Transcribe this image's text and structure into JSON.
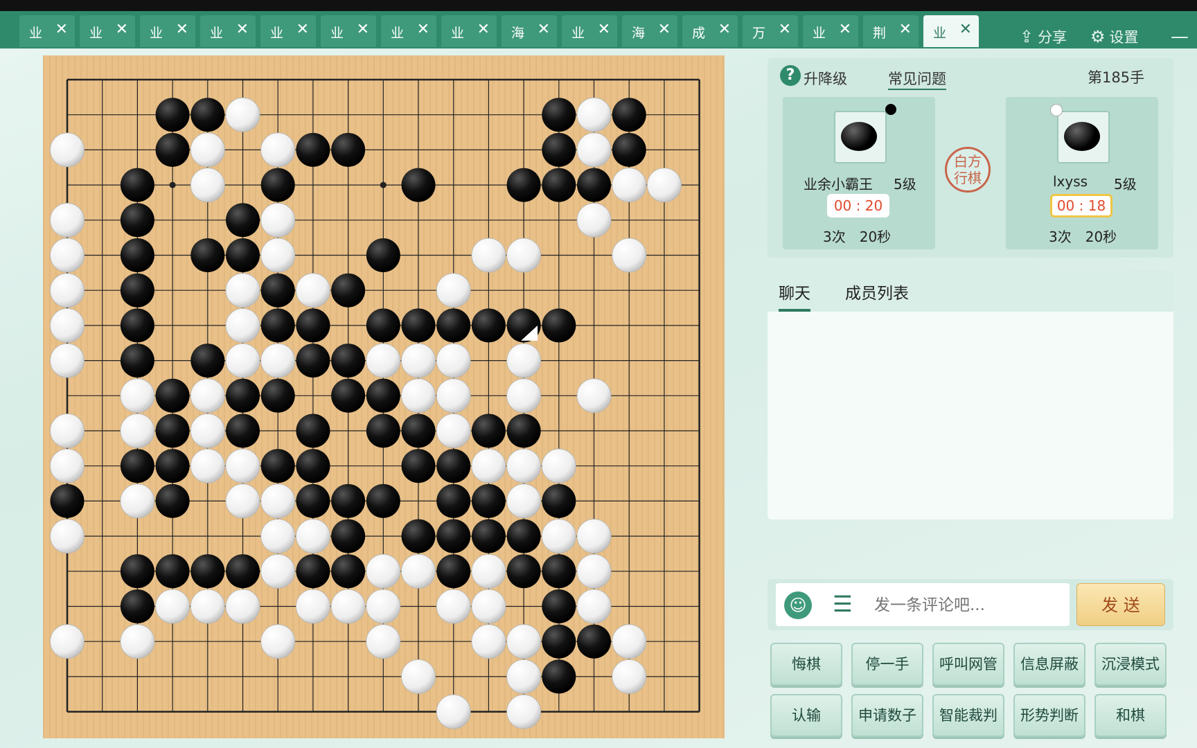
{
  "tabs": [
    {
      "label": "业",
      "close": "✕"
    },
    {
      "label": "业",
      "close": "✕"
    },
    {
      "label": "业",
      "close": "✕"
    },
    {
      "label": "业",
      "close": "✕"
    },
    {
      "label": "业",
      "close": "✕"
    },
    {
      "label": "业",
      "close": "✕"
    },
    {
      "label": "业",
      "close": "✕"
    },
    {
      "label": "业",
      "close": "✕"
    },
    {
      "label": "海",
      "close": "✕"
    },
    {
      "label": "业",
      "close": "✕"
    },
    {
      "label": "海",
      "close": "✕"
    },
    {
      "label": "成",
      "close": "✕"
    },
    {
      "label": "万",
      "close": "✕"
    },
    {
      "label": "业",
      "close": "✕"
    },
    {
      "label": "荆",
      "close": "✕"
    },
    {
      "label": "业",
      "close": "✕",
      "active": true
    }
  ],
  "topbar": {
    "share_label": "分享",
    "settings_label": "设置",
    "minimize_glyph": "—"
  },
  "board": {
    "size": 19,
    "last_move": [
      13,
      7
    ],
    "black": [
      [
        3,
        1
      ],
      [
        4,
        1
      ],
      [
        14,
        1
      ],
      [
        16,
        1
      ],
      [
        3,
        2
      ],
      [
        7,
        2
      ],
      [
        8,
        2
      ],
      [
        14,
        2
      ],
      [
        16,
        2
      ],
      [
        2,
        3
      ],
      [
        6,
        3
      ],
      [
        10,
        3
      ],
      [
        13,
        3
      ],
      [
        14,
        3
      ],
      [
        15,
        3
      ],
      [
        2,
        4
      ],
      [
        5,
        4
      ],
      [
        2,
        5
      ],
      [
        4,
        5
      ],
      [
        5,
        5
      ],
      [
        9,
        5
      ],
      [
        2,
        6
      ],
      [
        6,
        6
      ],
      [
        8,
        6
      ],
      [
        2,
        7
      ],
      [
        6,
        7
      ],
      [
        7,
        7
      ],
      [
        9,
        7
      ],
      [
        10,
        7
      ],
      [
        11,
        7
      ],
      [
        12,
        7
      ],
      [
        13,
        7
      ],
      [
        14,
        7
      ],
      [
        2,
        8
      ],
      [
        4,
        8
      ],
      [
        7,
        8
      ],
      [
        8,
        8
      ],
      [
        3,
        9
      ],
      [
        5,
        9
      ],
      [
        6,
        9
      ],
      [
        8,
        9
      ],
      [
        9,
        9
      ],
      [
        3,
        10
      ],
      [
        5,
        10
      ],
      [
        7,
        10
      ],
      [
        9,
        10
      ],
      [
        10,
        10
      ],
      [
        12,
        10
      ],
      [
        13,
        10
      ],
      [
        2,
        11
      ],
      [
        3,
        11
      ],
      [
        6,
        11
      ],
      [
        7,
        11
      ],
      [
        10,
        11
      ],
      [
        11,
        11
      ],
      [
        0,
        12
      ],
      [
        3,
        12
      ],
      [
        7,
        12
      ],
      [
        8,
        12
      ],
      [
        9,
        12
      ],
      [
        11,
        12
      ],
      [
        12,
        12
      ],
      [
        14,
        12
      ],
      [
        8,
        13
      ],
      [
        10,
        13
      ],
      [
        11,
        13
      ],
      [
        12,
        13
      ],
      [
        13,
        13
      ],
      [
        2,
        14
      ],
      [
        3,
        14
      ],
      [
        4,
        14
      ],
      [
        5,
        14
      ],
      [
        7,
        14
      ],
      [
        8,
        14
      ],
      [
        11,
        14
      ],
      [
        13,
        14
      ],
      [
        14,
        14
      ],
      [
        2,
        15
      ],
      [
        14,
        15
      ],
      [
        14,
        16
      ],
      [
        15,
        16
      ],
      [
        14,
        17
      ]
    ],
    "white": [
      [
        5,
        1
      ],
      [
        15,
        1
      ],
      [
        0,
        2
      ],
      [
        4,
        2
      ],
      [
        6,
        2
      ],
      [
        15,
        2
      ],
      [
        4,
        3
      ],
      [
        16,
        3
      ],
      [
        17,
        3
      ],
      [
        0,
        4
      ],
      [
        6,
        4
      ],
      [
        15,
        4
      ],
      [
        0,
        5
      ],
      [
        6,
        5
      ],
      [
        12,
        5
      ],
      [
        13,
        5
      ],
      [
        16,
        5
      ],
      [
        0,
        6
      ],
      [
        5,
        6
      ],
      [
        7,
        6
      ],
      [
        11,
        6
      ],
      [
        0,
        7
      ],
      [
        5,
        7
      ],
      [
        0,
        8
      ],
      [
        5,
        8
      ],
      [
        6,
        8
      ],
      [
        9,
        8
      ],
      [
        10,
        8
      ],
      [
        11,
        8
      ],
      [
        13,
        8
      ],
      [
        2,
        9
      ],
      [
        4,
        9
      ],
      [
        10,
        9
      ],
      [
        11,
        9
      ],
      [
        13,
        9
      ],
      [
        15,
        9
      ],
      [
        0,
        10
      ],
      [
        2,
        10
      ],
      [
        4,
        10
      ],
      [
        11,
        10
      ],
      [
        0,
        11
      ],
      [
        4,
        11
      ],
      [
        5,
        11
      ],
      [
        12,
        11
      ],
      [
        13,
        11
      ],
      [
        14,
        11
      ],
      [
        2,
        12
      ],
      [
        5,
        12
      ],
      [
        6,
        12
      ],
      [
        13,
        12
      ],
      [
        0,
        13
      ],
      [
        6,
        13
      ],
      [
        7,
        13
      ],
      [
        14,
        13
      ],
      [
        15,
        13
      ],
      [
        6,
        14
      ],
      [
        9,
        14
      ],
      [
        10,
        14
      ],
      [
        12,
        14
      ],
      [
        15,
        14
      ],
      [
        3,
        15
      ],
      [
        4,
        15
      ],
      [
        5,
        15
      ],
      [
        7,
        15
      ],
      [
        8,
        15
      ],
      [
        9,
        15
      ],
      [
        11,
        15
      ],
      [
        12,
        15
      ],
      [
        15,
        15
      ],
      [
        0,
        16
      ],
      [
        2,
        16
      ],
      [
        6,
        16
      ],
      [
        9,
        16
      ],
      [
        12,
        16
      ],
      [
        13,
        16
      ],
      [
        16,
        16
      ],
      [
        10,
        17
      ],
      [
        13,
        17
      ],
      [
        16,
        17
      ],
      [
        11,
        18
      ],
      [
        13,
        18
      ]
    ]
  },
  "info": {
    "rank_help_label": "升降级",
    "faq_label": "常见问题",
    "move_label": "第185手",
    "turn_line1": "白方",
    "turn_line2": "行棋",
    "black_player": {
      "name": "业余小霸王",
      "rank": "5级",
      "time": "00 : 20",
      "byoyomi": "3次　20秒"
    },
    "white_player": {
      "name": "lxyss",
      "rank": "5级",
      "time": "00 : 18",
      "byoyomi": "3次　20秒"
    }
  },
  "chat": {
    "tab_chat": "聊天",
    "tab_members": "成员列表"
  },
  "comment": {
    "placeholder": "发一条评论吧...",
    "send_label": "发 送"
  },
  "actions": {
    "row1": [
      "悔棋",
      "停一手",
      "呼叫网管",
      "信息屏蔽",
      "沉浸模式"
    ],
    "row2": [
      "认输",
      "申请数子",
      "智能裁判",
      "形势判断",
      "和棋"
    ]
  }
}
